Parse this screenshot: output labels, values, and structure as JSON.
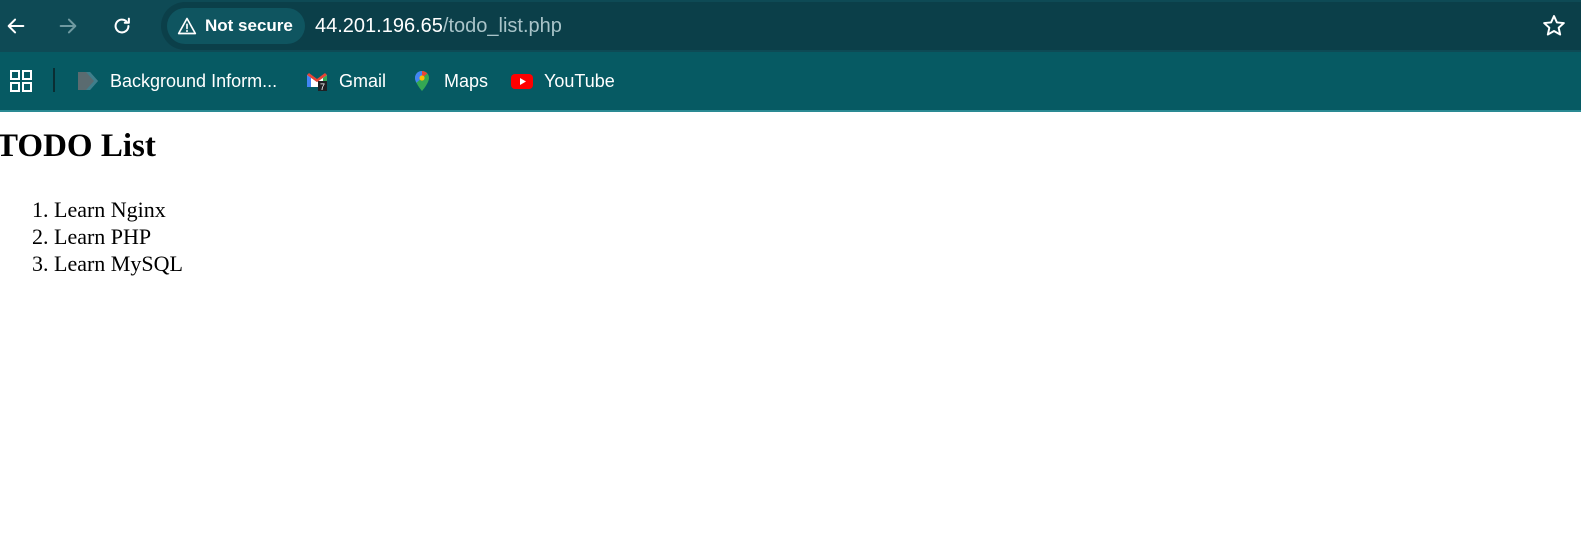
{
  "browser": {
    "security_label": "Not secure",
    "url_host": "44.201.196.65",
    "url_path": "/todo_list.php",
    "bookmarks": [
      {
        "label": "Background Inform...",
        "icon": "document-icon"
      },
      {
        "label": "Gmail",
        "icon": "gmail-icon"
      },
      {
        "label": "Maps",
        "icon": "maps-icon"
      },
      {
        "label": "YouTube",
        "icon": "youtube-icon"
      }
    ],
    "colors": {
      "toolbar": "#0e4a55",
      "omnibox": "#0b3f49",
      "bookmarks_bar": "#065a63"
    }
  },
  "page": {
    "title": "TODO List",
    "items": [
      "Learn Nginx",
      "Learn PHP",
      "Learn MySQL"
    ]
  }
}
